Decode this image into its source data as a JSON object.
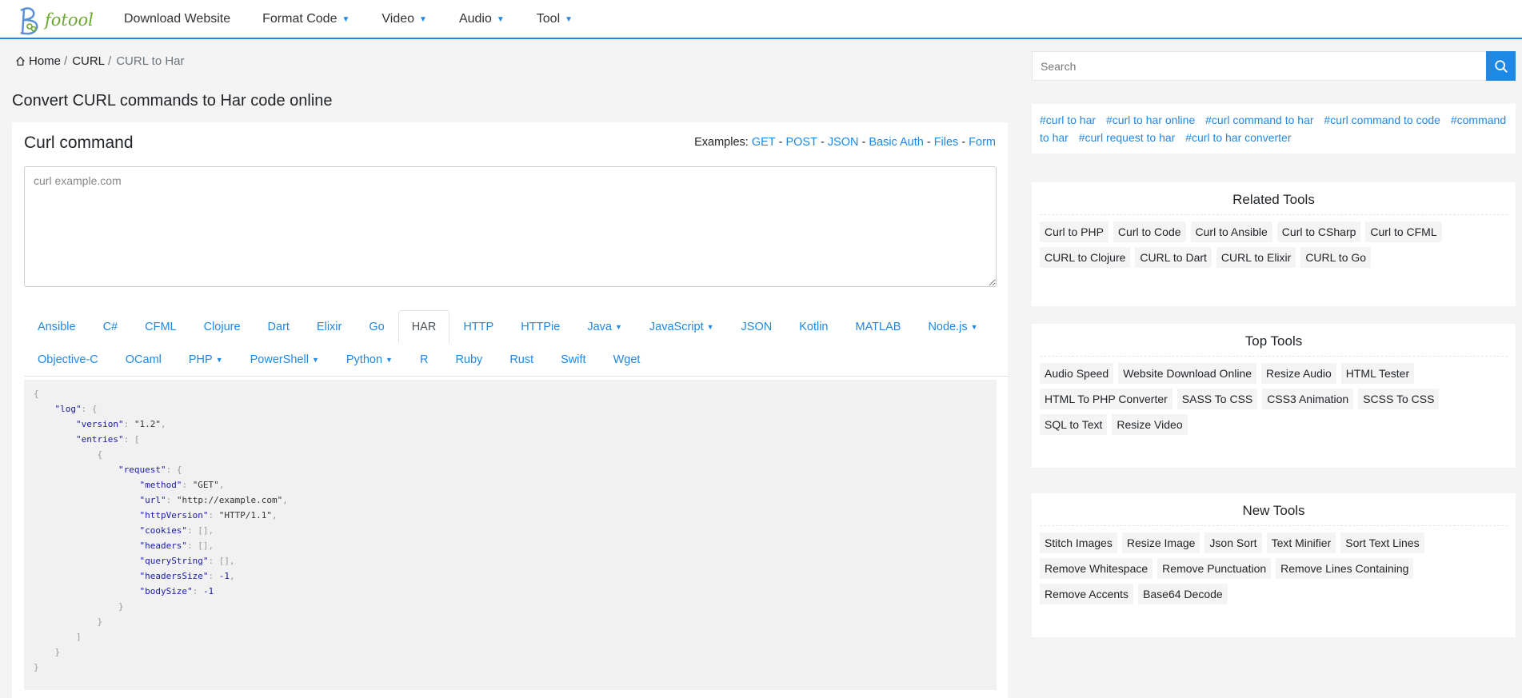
{
  "logo": {
    "text": "fotool"
  },
  "nav": [
    {
      "label": "Download Website",
      "dropdown": false
    },
    {
      "label": "Format Code",
      "dropdown": true
    },
    {
      "label": "Video",
      "dropdown": true
    },
    {
      "label": "Audio",
      "dropdown": true
    },
    {
      "label": "Tool",
      "dropdown": true
    }
  ],
  "breadcrumb": {
    "home": "Home",
    "curl": "CURL",
    "current": "CURL to Har",
    "sep": "/"
  },
  "page_title": "Convert CURL commands to Har code online",
  "editor": {
    "title": "Curl command",
    "examples_label": "Examples:",
    "examples": [
      "GET",
      "POST",
      "JSON",
      "Basic Auth",
      "Files",
      "Form"
    ],
    "placeholder": "curl example.com",
    "value": ""
  },
  "tabs": {
    "row1": [
      {
        "label": "Ansible",
        "dropdown": false,
        "active": false
      },
      {
        "label": "C#",
        "dropdown": false,
        "active": false
      },
      {
        "label": "CFML",
        "dropdown": false,
        "active": false
      },
      {
        "label": "Clojure",
        "dropdown": false,
        "active": false
      },
      {
        "label": "Dart",
        "dropdown": false,
        "active": false
      },
      {
        "label": "Elixir",
        "dropdown": false,
        "active": false
      },
      {
        "label": "Go",
        "dropdown": false,
        "active": false
      },
      {
        "label": "HAR",
        "dropdown": false,
        "active": true
      },
      {
        "label": "HTTP",
        "dropdown": false,
        "active": false
      },
      {
        "label": "HTTPie",
        "dropdown": false,
        "active": false
      },
      {
        "label": "Java",
        "dropdown": true,
        "active": false
      },
      {
        "label": "JavaScript",
        "dropdown": true,
        "active": false
      },
      {
        "label": "JSON",
        "dropdown": false,
        "active": false
      },
      {
        "label": "Kotlin",
        "dropdown": false,
        "active": false
      },
      {
        "label": "MATLAB",
        "dropdown": false,
        "active": false
      },
      {
        "label": "Node.js",
        "dropdown": true,
        "active": false
      }
    ],
    "row2": [
      {
        "label": "Objective-C",
        "dropdown": false,
        "active": false
      },
      {
        "label": "OCaml",
        "dropdown": false,
        "active": false
      },
      {
        "label": "PHP",
        "dropdown": true,
        "active": false
      },
      {
        "label": "PowerShell",
        "dropdown": true,
        "active": false
      },
      {
        "label": "Python",
        "dropdown": true,
        "active": false
      },
      {
        "label": "R",
        "dropdown": false,
        "active": false
      },
      {
        "label": "Ruby",
        "dropdown": false,
        "active": false
      },
      {
        "label": "Rust",
        "dropdown": false,
        "active": false
      },
      {
        "label": "Swift",
        "dropdown": false,
        "active": false
      },
      {
        "label": "Wget",
        "dropdown": false,
        "active": false
      }
    ]
  },
  "output": {
    "log_key": "\"log\"",
    "version_key": "\"version\"",
    "version_val": "\"1.2\"",
    "entries_key": "\"entries\"",
    "request_key": "\"request\"",
    "method_key": "\"method\"",
    "method_val": "\"GET\"",
    "url_key": "\"url\"",
    "url_val": "\"http://example.com\"",
    "http_key": "\"httpVersion\"",
    "http_val": "\"HTTP/1.1\"",
    "cookies_key": "\"cookies\"",
    "headers_key": "\"headers\"",
    "query_key": "\"queryString\"",
    "hsize_key": "\"headersSize\"",
    "hsize_val": "-1",
    "bsize_key": "\"bodySize\"",
    "bsize_val": "-1"
  },
  "search": {
    "placeholder": "Search"
  },
  "tags": [
    "#curl to har",
    "#curl to har online",
    "#curl command to har",
    "#curl command to code",
    "#command to har",
    "#curl request to har",
    "#curl to har converter"
  ],
  "related_tools": {
    "title": "Related Tools",
    "items": [
      "Curl to PHP",
      "Curl to Code",
      "Curl to Ansible",
      "Curl to CSharp",
      "Curl to CFML",
      "CURL to Clojure",
      "CURL to Dart",
      "CURL to Elixir",
      "CURL to Go"
    ]
  },
  "top_tools": {
    "title": "Top Tools",
    "items": [
      "Audio Speed",
      "Website Download Online",
      "Resize Audio",
      "HTML Tester",
      "HTML To PHP Converter",
      "SASS To CSS",
      "CSS3 Animation",
      "SCSS To CSS",
      "SQL to Text",
      "Resize Video"
    ]
  },
  "new_tools": {
    "title": "New Tools",
    "items": [
      "Stitch Images",
      "Resize Image",
      "Json Sort",
      "Text Minifier",
      "Sort Text Lines",
      "Remove Whitespace",
      "Remove Punctuation",
      "Remove Lines Containing",
      "Remove Accents",
      "Base64 Decode"
    ]
  },
  "colors": {
    "accent": "#1e88e5",
    "logo_green": "#6aa82f"
  },
  "icons": {
    "home": "home-icon",
    "search": "search-icon",
    "caret": "caret-down-icon"
  }
}
